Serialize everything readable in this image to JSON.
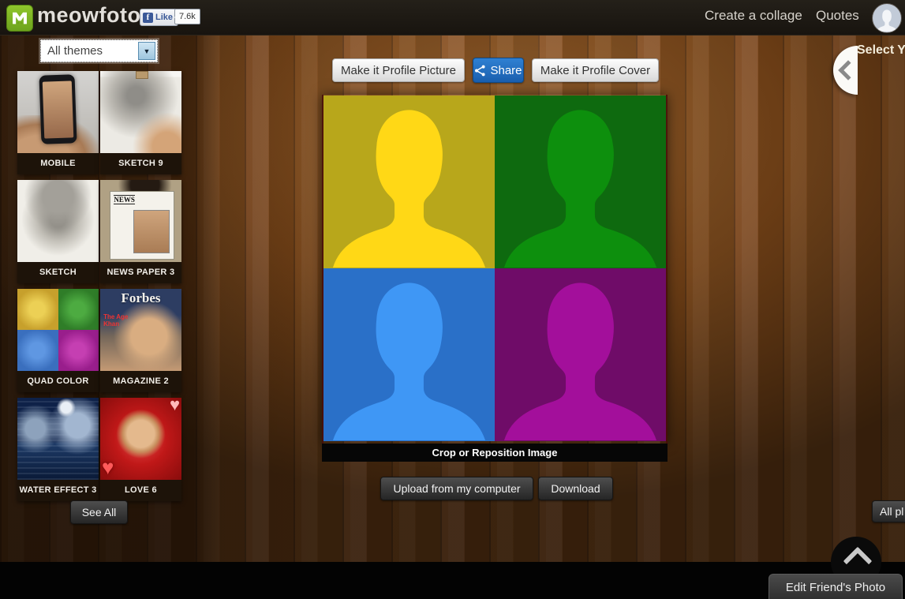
{
  "header": {
    "brand": "meowfoto",
    "facebook": {
      "like_label": "Like",
      "like_count": "7.6k",
      "f_glyph": "f"
    },
    "nav_items": [
      {
        "label": "Create a collage"
      },
      {
        "label": "Quotes"
      }
    ]
  },
  "sidebar": {
    "themes_dropdown": {
      "selected": "All themes",
      "arrow_glyph": "▼"
    },
    "themes": [
      {
        "label": "MOBILE"
      },
      {
        "label": "SKETCH 9"
      },
      {
        "label": "SKETCH"
      },
      {
        "label": "NEWS PAPER 3",
        "art_text": "NEWS"
      },
      {
        "label": "QUAD COLOR"
      },
      {
        "label": "MAGAZINE 2",
        "art_text": "Forbes",
        "art_subtext": "The Age Khan"
      },
      {
        "label": "WATER EFFECT 3"
      },
      {
        "label": "LOVE 6",
        "heart_glyph": "♥"
      }
    ],
    "see_all_label": "See All"
  },
  "toolbar": {
    "make_profile_picture": "Make it Profile Picture",
    "share_label": "Share",
    "make_profile_cover": "Make it Profile Cover"
  },
  "canvas": {
    "crop_label": "Crop or Reposition Image",
    "quadrants": [
      {
        "name": "top-left",
        "bg": "#b8a71b",
        "silhouette": "#ffd816"
      },
      {
        "name": "top-right",
        "bg": "#0e6a0f",
        "silhouette": "#0d8f0d"
      },
      {
        "name": "bottom-left",
        "bg": "#2a70c8",
        "silhouette": "#3f97f5"
      },
      {
        "name": "bottom-right",
        "bg": "#6f0c68",
        "silhouette": "#a30f9b"
      }
    ]
  },
  "actions": {
    "upload_label": "Upload from my computer",
    "download_label": "Download"
  },
  "right_panel": {
    "select_label": "Select Yo",
    "all_photos_label": "All pl"
  },
  "footer": {
    "edit_friend_label": "Edit Friend's Photo"
  }
}
